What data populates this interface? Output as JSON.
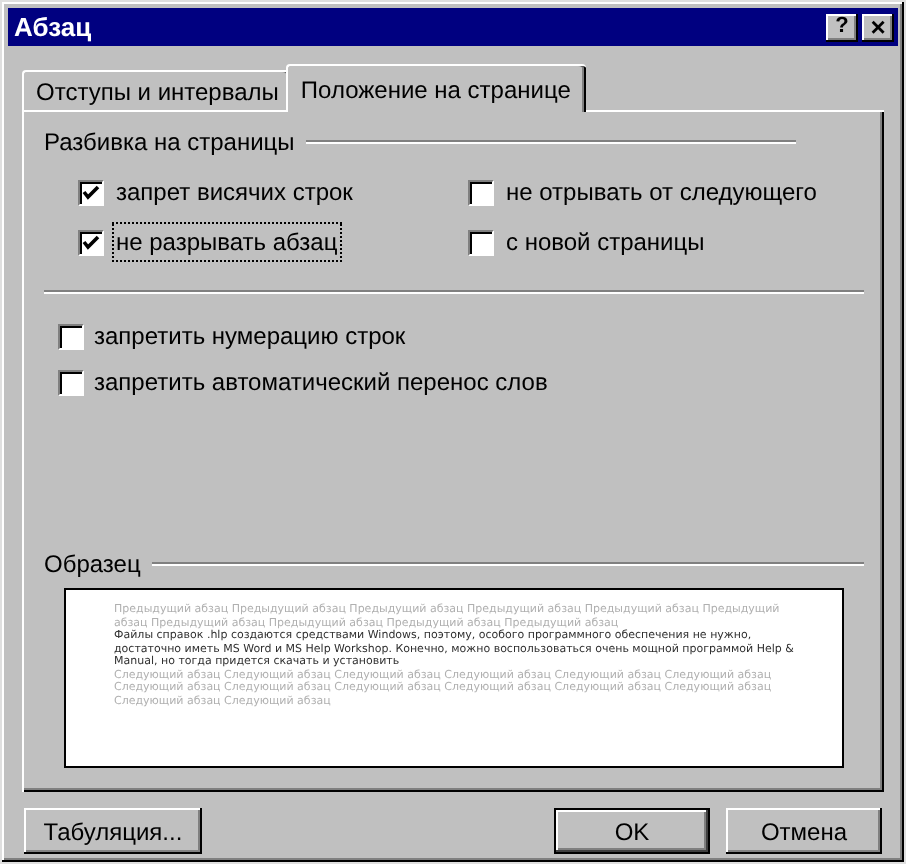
{
  "window": {
    "title": "Абзац",
    "help_button": "?",
    "close_button": "×"
  },
  "tabs": [
    {
      "label": "Отступы и интервалы",
      "selected": false
    },
    {
      "label": "Положение на странице",
      "selected": true
    }
  ],
  "pagination": {
    "title": "Разбивка на страницы",
    "options": [
      {
        "label": "запрет висячих строк",
        "checked": true,
        "focused": false
      },
      {
        "label": "не отрывать от следующего",
        "checked": false,
        "focused": false
      },
      {
        "label": "не разрывать абзац",
        "checked": true,
        "focused": true
      },
      {
        "label": "с новой страницы",
        "checked": false,
        "focused": false
      }
    ]
  },
  "other_options": [
    {
      "label": "запретить нумерацию строк",
      "checked": false
    },
    {
      "label": "запретить автоматический перенос слов",
      "checked": false
    }
  ],
  "preview": {
    "title": "Образец",
    "previous_text": "Предыдущий абзац Предыдущий абзац Предыдущий абзац Предыдущий абзац Предыдущий абзац Предыдущий абзац Предыдущий абзац Предыдущий абзац Предыдущий абзац Предыдущий абзац",
    "current_text": "Файлы справок .hlp создаются средствами Windows, поэтому, особого программного обеспечения не нужно, достаточно иметь MS Word и MS Help Workshop. Конечно, можно воспользоваться очень мощной программой Help & Manual, но тогда придется скачать и установить",
    "next_text": "Следующий абзац Следующий абзац Следующий абзац Следующий абзац Следующий абзац Следующий абзац Следующий абзац Следующий абзац Следующий абзац Следующий абзац Следующий абзац Следующий абзац Следующий абзац Следующий абзац"
  },
  "buttons": [
    {
      "label": "Табуляция...",
      "kind": "left",
      "default": false
    },
    {
      "label": "OK",
      "kind": "right",
      "default": true
    },
    {
      "label": "Отмена",
      "kind": "right",
      "default": false
    }
  ]
}
